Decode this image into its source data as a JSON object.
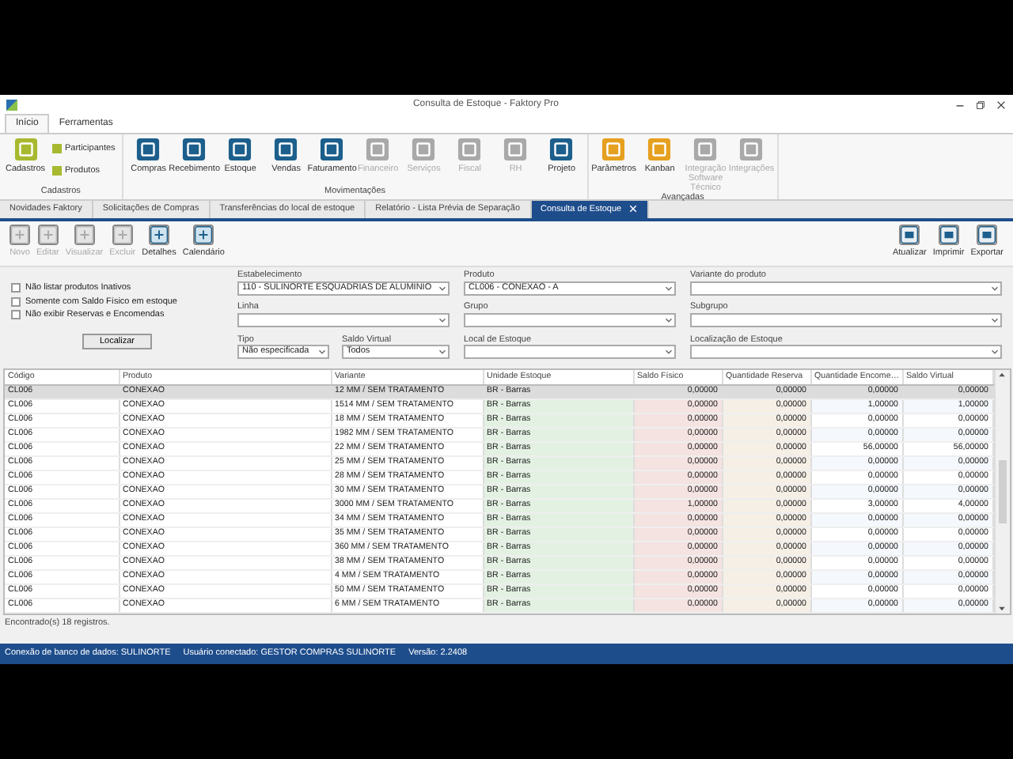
{
  "window": {
    "title": "Consulta de Estoque - Faktory Pro"
  },
  "ribbon_tabs": [
    {
      "label": "Início",
      "selected": true
    },
    {
      "label": "Ferramentas",
      "selected": false
    }
  ],
  "ribbon_groups": [
    {
      "label": "Cadastros",
      "buttons": [
        {
          "label": "Cadastros",
          "kind": "large",
          "disabled": false
        },
        {
          "label": "Participantes",
          "kind": "small",
          "disabled": false
        },
        {
          "label": "Produtos",
          "kind": "small",
          "disabled": false
        }
      ]
    },
    {
      "label": "Movimentações",
      "buttons": [
        {
          "label": "Compras",
          "kind": "large",
          "disabled": false
        },
        {
          "label": "Recebimento",
          "kind": "large",
          "disabled": false
        },
        {
          "label": "Estoque",
          "kind": "large",
          "disabled": false
        },
        {
          "label": "Vendas",
          "kind": "large",
          "disabled": false
        },
        {
          "label": "Faturamento",
          "kind": "large",
          "disabled": false
        },
        {
          "label": "Financeiro",
          "kind": "large",
          "disabled": true
        },
        {
          "label": "Serviços",
          "kind": "large",
          "disabled": true
        },
        {
          "label": "Fiscal",
          "kind": "large",
          "disabled": true
        },
        {
          "label": "RH",
          "kind": "large",
          "disabled": true
        },
        {
          "label": "Projeto",
          "kind": "large",
          "disabled": false
        }
      ]
    },
    {
      "label": "Avançadas",
      "buttons": [
        {
          "label": "Parâmetros",
          "kind": "large",
          "disabled": false
        },
        {
          "label": "Kanban",
          "kind": "large",
          "disabled": false
        },
        {
          "label": "Integração Software Técnico",
          "kind": "large",
          "disabled": true
        },
        {
          "label": "Integrações",
          "kind": "large",
          "disabled": true
        }
      ]
    }
  ],
  "document_tabs": [
    {
      "label": "Novidades Faktory",
      "selected": false
    },
    {
      "label": "Solicitações de Compras",
      "selected": false
    },
    {
      "label": "Transferências do local de estoque",
      "selected": false
    },
    {
      "label": "Relatório - Lista Prévia de Separação",
      "selected": false
    },
    {
      "label": "Consulta de Estoque",
      "selected": true
    }
  ],
  "toolbar": [
    {
      "label": "Novo",
      "disabled": true
    },
    {
      "label": "Editar",
      "disabled": true
    },
    {
      "label": "Visualizar",
      "disabled": true
    },
    {
      "label": "Excluir",
      "disabled": true
    },
    {
      "label": "Detalhes",
      "disabled": false
    },
    {
      "label": "Calendário",
      "disabled": false
    }
  ],
  "toolbar_right": [
    {
      "label": "Atualizar"
    },
    {
      "label": "Imprimir"
    },
    {
      "label": "Exportar"
    }
  ],
  "filters": [
    {
      "label": "Estabelecimento",
      "value": "110 - SULINORTE ESQUADRIAS DE ALUMINIO"
    },
    {
      "label": "Produto",
      "value": "CL006 - CONEXAO - A"
    },
    {
      "label": "Variante do produto"
    },
    {
      "label": "Linha"
    },
    {
      "label": "Grupo"
    },
    {
      "label": "Subgrupo"
    },
    {
      "label": "Tipo",
      "value": "Não especificada"
    },
    {
      "label": "Saldo Virtual",
      "value": "Todos"
    },
    {
      "label": "Local de Estoque"
    },
    {
      "label": "Localização de Estoque"
    }
  ],
  "options": [
    {
      "label": "Não listar produtos Inativos",
      "checked": false
    },
    {
      "label": "Somente com Saldo Físico em estoque",
      "checked": false
    },
    {
      "label": "Não exibir Reservas e Encomendas",
      "checked": false
    }
  ],
  "search_button": "Localizar",
  "table": {
    "columns": [
      {
        "label": "Código"
      },
      {
        "label": "Produto"
      },
      {
        "label": "Variante"
      },
      {
        "label": "Unidade Estoque",
        "color": "#e3f1e3"
      },
      {
        "label": "Saldo Físico",
        "color": "#f4e3e1"
      },
      {
        "label": "Quantidade Reserva",
        "color": "#f6efe6"
      },
      {
        "label": "Quantidade Encome…"
      },
      {
        "label": "Saldo Virtual"
      }
    ],
    "rows": [
      {
        "selected": true,
        "cells": [
          "CL006",
          "CONEXAO",
          "12 MM / SEM TRATAMENTO",
          "BR - Barras",
          "0,00000",
          "0,00000",
          "0,00000",
          "0,00000"
        ]
      },
      {
        "selected": false,
        "cells": [
          "CL006",
          "CONEXAO",
          "1514 MM / SEM TRATAMENTO",
          "BR - Barras",
          "0,00000",
          "0,00000",
          "1,00000",
          "1,00000"
        ]
      },
      {
        "selected": false,
        "cells": [
          "CL006",
          "CONEXAO",
          "18 MM / SEM TRATAMENTO",
          "BR - Barras",
          "0,00000",
          "0,00000",
          "0,00000",
          "0,00000"
        ]
      },
      {
        "selected": false,
        "cells": [
          "CL006",
          "CONEXAO",
          "1982 MM / SEM TRATAMENTO",
          "BR - Barras",
          "0,00000",
          "0,00000",
          "0,00000",
          "0,00000"
        ]
      },
      {
        "selected": false,
        "cells": [
          "CL006",
          "CONEXAO",
          "22 MM / SEM TRATAMENTO",
          "BR - Barras",
          "0,00000",
          "0,00000",
          "56,00000",
          "56,00000"
        ]
      },
      {
        "selected": false,
        "cells": [
          "CL006",
          "CONEXAO",
          "25 MM / SEM TRATAMENTO",
          "BR - Barras",
          "0,00000",
          "0,00000",
          "0,00000",
          "0,00000"
        ]
      },
      {
        "selected": false,
        "cells": [
          "CL006",
          "CONEXAO",
          "28 MM / SEM TRATAMENTO",
          "BR - Barras",
          "0,00000",
          "0,00000",
          "0,00000",
          "0,00000"
        ]
      },
      {
        "selected": false,
        "cells": [
          "CL006",
          "CONEXAO",
          "30 MM / SEM TRATAMENTO",
          "BR - Barras",
          "0,00000",
          "0,00000",
          "0,00000",
          "0,00000"
        ]
      },
      {
        "selected": false,
        "cells": [
          "CL006",
          "CONEXAO",
          "3000 MM / SEM TRATAMENTO",
          "BR - Barras",
          "1,00000",
          "0,00000",
          "3,00000",
          "4,00000"
        ]
      },
      {
        "selected": false,
        "cells": [
          "CL006",
          "CONEXAO",
          "34 MM / SEM TRATAMENTO",
          "BR - Barras",
          "0,00000",
          "0,00000",
          "0,00000",
          "0,00000"
        ]
      },
      {
        "selected": false,
        "cells": [
          "CL006",
          "CONEXAO",
          "35 MM / SEM TRATAMENTO",
          "BR - Barras",
          "0,00000",
          "0,00000",
          "0,00000",
          "0,00000"
        ]
      },
      {
        "selected": false,
        "cells": [
          "CL006",
          "CONEXAO",
          "360 MM / SEM TRATAMENTO",
          "BR - Barras",
          "0,00000",
          "0,00000",
          "0,00000",
          "0,00000"
        ]
      },
      {
        "selected": false,
        "cells": [
          "CL006",
          "CONEXAO",
          "38 MM / SEM TRATAMENTO",
          "BR - Barras",
          "0,00000",
          "0,00000",
          "0,00000",
          "0,00000"
        ]
      },
      {
        "selected": false,
        "cells": [
          "CL006",
          "CONEXAO",
          "4 MM / SEM TRATAMENTO",
          "BR - Barras",
          "0,00000",
          "0,00000",
          "0,00000",
          "0,00000"
        ]
      },
      {
        "selected": false,
        "cells": [
          "CL006",
          "CONEXAO",
          "50 MM / SEM TRATAMENTO",
          "BR - Barras",
          "0,00000",
          "0,00000",
          "0,00000",
          "0,00000"
        ]
      },
      {
        "selected": false,
        "cells": [
          "CL006",
          "CONEXAO",
          "6 MM / SEM TRATAMENTO",
          "BR - Barras",
          "0,00000",
          "0,00000",
          "0,00000",
          "0,00000"
        ]
      }
    ]
  },
  "record_count": "Encontrado(s) 18 registros.",
  "status_bar": [
    "Conexão de banco de dados: SULINORTE",
    "Usuário conectado: GESTOR COMPRAS SULINORTE",
    "Versão: 2.2408"
  ]
}
